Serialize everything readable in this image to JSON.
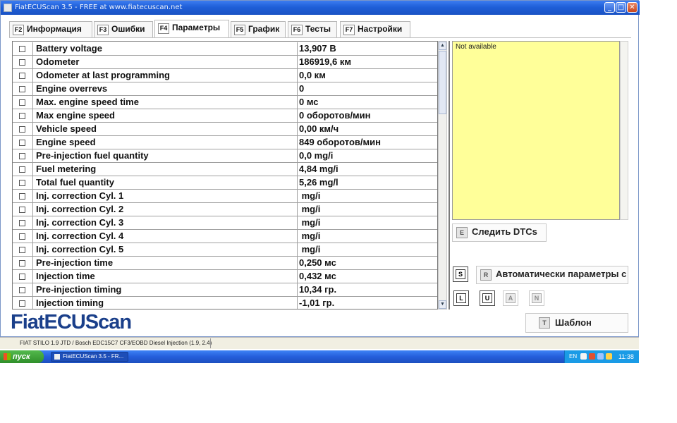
{
  "window": {
    "title": "FiatECUScan 3.5 - FREE at www.fiatecuscan.net"
  },
  "tabs": [
    {
      "key": "F2",
      "label": "Информация"
    },
    {
      "key": "F3",
      "label": "Ошибки"
    },
    {
      "key": "F4",
      "label": "Параметры",
      "active": true
    },
    {
      "key": "F5",
      "label": "График"
    },
    {
      "key": "F6",
      "label": "Тесты"
    },
    {
      "key": "F7",
      "label": "Настройки"
    }
  ],
  "params": [
    {
      "name": "Battery voltage",
      "value": "13,907 В"
    },
    {
      "name": "Odometer",
      "value": "186919,6 км"
    },
    {
      "name": "Odometer at last programming",
      "value": "0,0 км"
    },
    {
      "name": "Engine overrevs",
      "value": "0"
    },
    {
      "name": "Max. engine speed time",
      "value": "0 мс"
    },
    {
      "name": "Max engine speed",
      "value": "0 оборотов/мин"
    },
    {
      "name": "Vehicle speed",
      "value": "0,00 км/ч"
    },
    {
      "name": "Engine speed",
      "value": "849 оборотов/мин"
    },
    {
      "name": "Pre-injection fuel quantity",
      "value": "0,0 mg/i"
    },
    {
      "name": "Fuel metering",
      "value": "4,84 mg/i"
    },
    {
      "name": "Total fuel quantity",
      "value": "5,26 mg/l"
    },
    {
      "name": "Inj. correction Cyl. 1",
      "value": " mg/i"
    },
    {
      "name": "Inj. correction Cyl. 2",
      "value": " mg/i"
    },
    {
      "name": "Inj. correction Cyl. 3",
      "value": " mg/i"
    },
    {
      "name": "Inj. correction Cyl. 4",
      "value": " mg/i"
    },
    {
      "name": "Inj. correction Cyl. 5",
      "value": " mg/i"
    },
    {
      "name": "Pre-injection time",
      "value": "0,250 мс"
    },
    {
      "name": "Injection time",
      "value": "0,432 мс"
    },
    {
      "name": "Pre-injection timing",
      "value": "10,34 гр."
    },
    {
      "name": "Injection timing",
      "value": "-1,01 гр."
    }
  ],
  "dtc": {
    "status": "Not available",
    "follow_key": "E",
    "follow_label": "Следить DTCs"
  },
  "controls": {
    "s_key": "S",
    "auto_key": "R",
    "auto_label": "Автоматически параметры с",
    "l_key": "L",
    "u_key": "U",
    "a_key": "A",
    "n_key": "N",
    "template_key": "T",
    "template_label": "Шаблон"
  },
  "logo": "FiatECUScan",
  "status": {
    "vehicle": "FIAT STILO 1.9 JTD / Bosch EDC15C7 CF3/EOBD Diesel Injection (1.9, 2.4)"
  },
  "taskbar": {
    "start_label": "пуск",
    "task_label": "FiatECUScan 3.5 - FR...",
    "lang": "EN",
    "clock": "11:38"
  },
  "colors": {
    "dtc_background": "#ffff99",
    "logo": "#1a3f8a",
    "titlebar": "#245edb"
  }
}
